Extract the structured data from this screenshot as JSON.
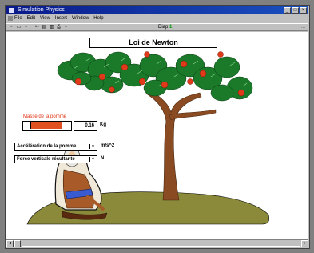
{
  "window": {
    "title": "Simulation Physics"
  },
  "menubar": {
    "items": [
      "File",
      "Edit",
      "View",
      "Insert",
      "Window",
      "Help"
    ]
  },
  "toolbar": {
    "slide_indicator": "Diap",
    "slide_number": "1",
    "right_text": "..."
  },
  "page": {
    "title": "Loi de Newton"
  },
  "mass": {
    "label": "Masse de la pomme",
    "value": "0.16",
    "unit": "Kg",
    "level": 0.8
  },
  "acceleration": {
    "selected": "Accélération de la pomme",
    "unit": "m/s^2"
  },
  "force": {
    "selected": "Force verticale résultante",
    "unit": "N"
  },
  "colors": {
    "accent": "#e05020",
    "title_bar": "#0a1a8a",
    "grass": "#8a8a3a",
    "foliage": "#1a7a2a",
    "apple": "#e03a1a",
    "trunk": "#8a4a22"
  },
  "icons": [
    "app-icon",
    "minimize-icon",
    "maximize-icon",
    "close-icon",
    "scroll-left-icon",
    "scroll-right-icon"
  ]
}
